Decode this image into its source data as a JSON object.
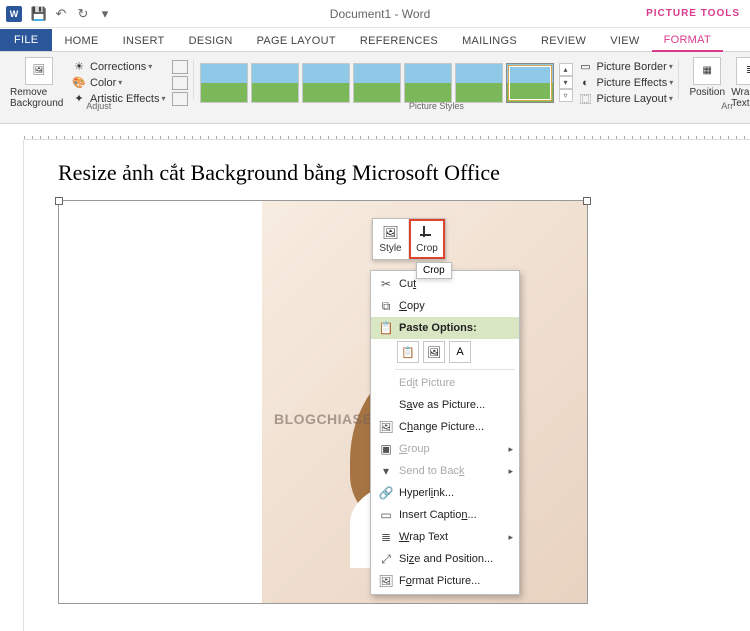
{
  "titlebar": {
    "app_glyph": "W",
    "doc_title": "Document1 - Word",
    "tool_tab": "PICTURE TOOLS"
  },
  "tabs": {
    "file": "FILE",
    "home": "HOME",
    "insert": "INSERT",
    "design": "DESIGN",
    "page_layout": "PAGE LAYOUT",
    "references": "REFERENCES",
    "mailings": "MAILINGS",
    "review": "REVIEW",
    "view": "VIEW",
    "format": "FORMAT"
  },
  "ribbon": {
    "remove_bg": "Remove Background",
    "corrections": "Corrections",
    "color": "Color",
    "artistic": "Artistic Effects",
    "adjust_label": "Adjust",
    "picture_styles_label": "Picture Styles",
    "picture_border": "Picture Border",
    "picture_effects": "Picture Effects",
    "picture_layout": "Picture Layout",
    "position": "Position",
    "wrap_text": "Wrap Text",
    "arrange_label": "Arr"
  },
  "document": {
    "heading": "Resize ảnh cắt Background bằng Microsoft Office",
    "watermark": "BLOGCHIASEKIENTHUC.COM"
  },
  "mini_toolbar": {
    "style": "Style",
    "crop": "Crop",
    "tooltip": "Crop"
  },
  "context_menu": {
    "cut": "Cut",
    "copy": "Copy",
    "paste_options": "Paste Options:",
    "edit_picture": "Edit Picture",
    "save_as_picture": "Save as Picture...",
    "change_picture": "Change Picture...",
    "group": "Group",
    "send_to_back": "Send to Back",
    "hyperlink": "Hyperlink...",
    "insert_caption": "Insert Caption...",
    "wrap_text": "Wrap Text",
    "size_position": "Size and Position...",
    "format_picture": "Format Picture..."
  }
}
